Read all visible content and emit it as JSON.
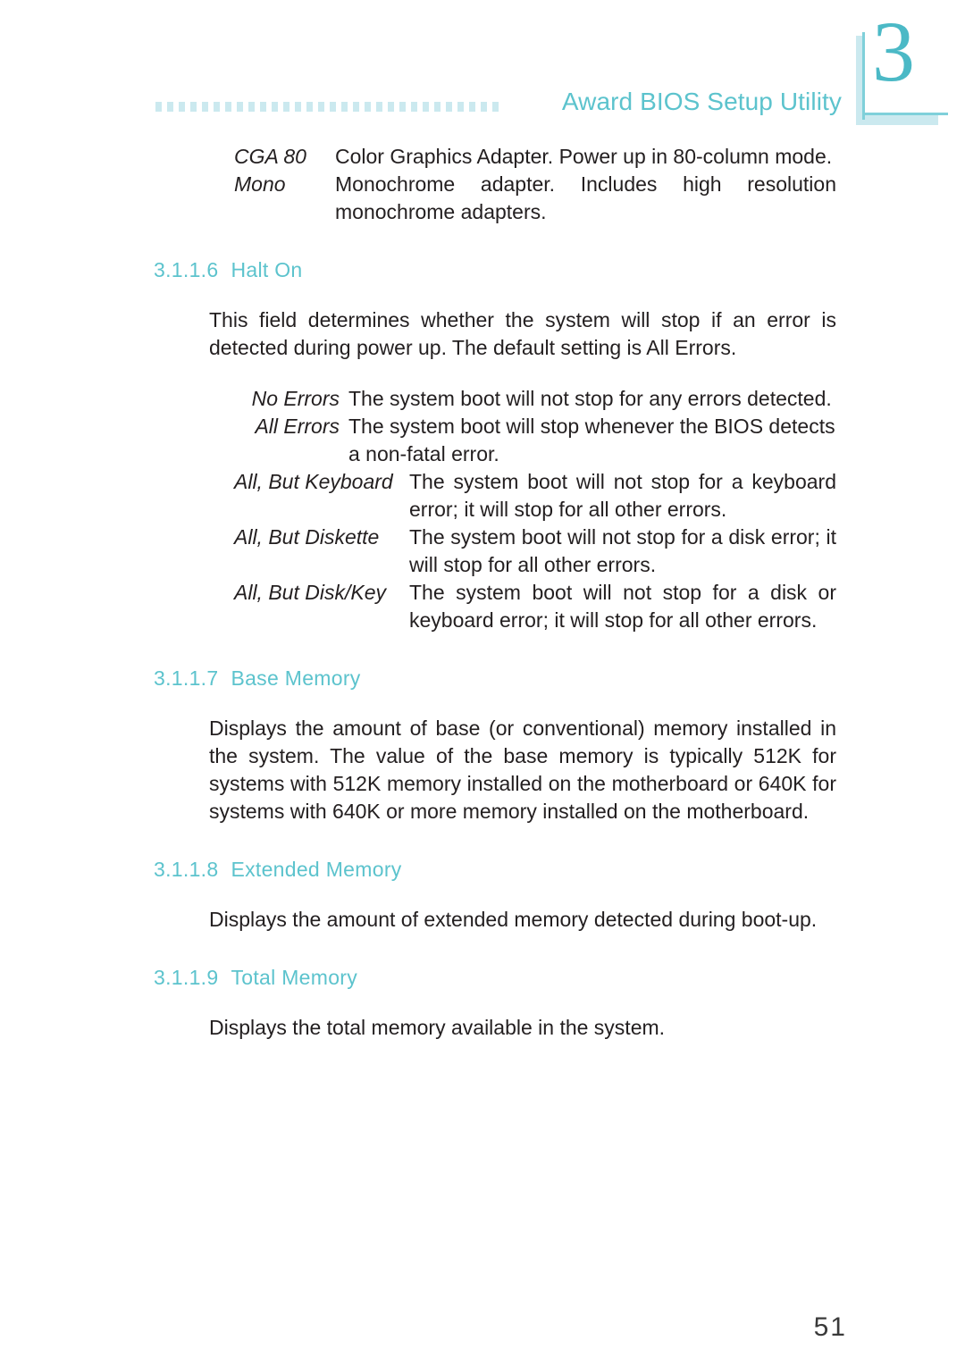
{
  "header": {
    "title": "Award BIOS Setup Utility",
    "dot_count": 30,
    "dot_color": "#cbe9ef",
    "title_color": "#5cc3cd"
  },
  "chapter_marker": {
    "number": "3",
    "number_color": "#4bb9c6",
    "rule_color": "#7fd0da",
    "shadow_color": "#cbe9ef"
  },
  "content": {
    "adapter_options": [
      {
        "term": "CGA 80",
        "description": "Color Graphics Adapter. Power up in 80-column mode."
      },
      {
        "term": "Mono",
        "description": "Monochrome adapter. Includes high resolution monochrome adapters."
      }
    ],
    "sections": [
      {
        "number": "3.1.1.6",
        "title": "Halt On",
        "body": "This field determines whether the system will stop if an error is detected during power up. The default setting is All Errors.",
        "options": [
          {
            "term": "No Errors",
            "description": "The system boot will not stop for any errors detected."
          },
          {
            "term": "All Errors",
            "description": "The system boot will stop whenever the BIOS detects a non-fatal error."
          },
          {
            "term": "All, But Keyboard",
            "description": "The system boot will not stop for a keyboard error; it will stop for all other errors."
          },
          {
            "term": "All, But Diskette",
            "description": "The system boot will not stop for a disk error; it will stop for all other errors."
          },
          {
            "term": "All, But Disk/Key",
            "description": "The system boot will not stop for a disk or keyboard error; it will stop for all other errors."
          }
        ]
      },
      {
        "number": "3.1.1.7",
        "title": "Base Memory",
        "body": "Displays the amount of base (or conventional) memory installed in the system. The value of the base memory is typically 512K for systems with 512K memory installed on the motherboard or 640K for systems with 640K or more memory installed on the motherboard."
      },
      {
        "number": "3.1.1.8",
        "title": "Extended Memory",
        "body": "Displays the amount of extended memory detected during boot-up."
      },
      {
        "number": "3.1.1.9",
        "title": "Total Memory",
        "body": "Displays the total memory available in the system."
      }
    ]
  },
  "footer": {
    "page_number": "51"
  }
}
